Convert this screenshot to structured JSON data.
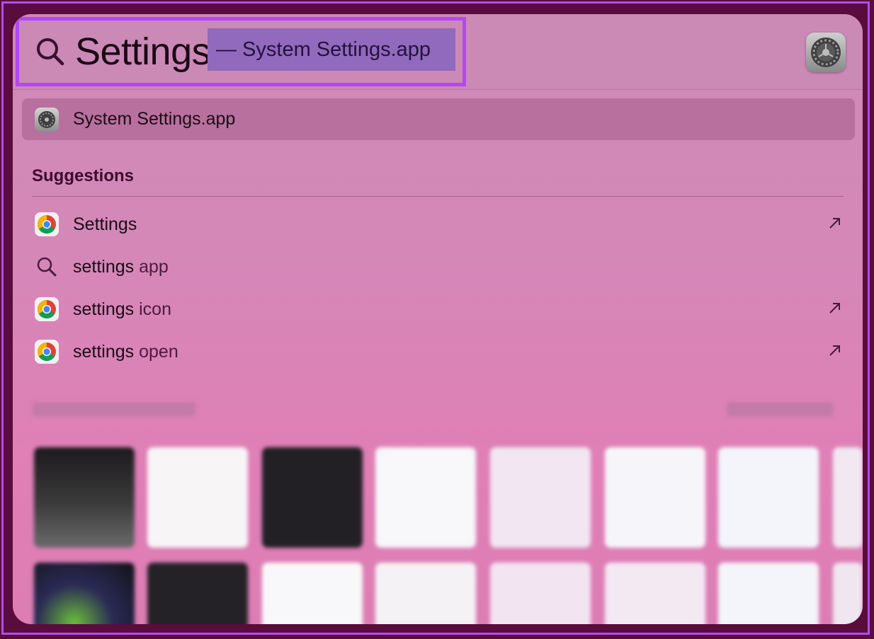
{
  "search": {
    "query": "Settings",
    "completion": "— System Settings.app"
  },
  "top_hit": {
    "label": "System Settings.app",
    "icon": "gear-icon"
  },
  "suggestions": {
    "title": "Suggestions",
    "items": [
      {
        "query_part": "Settings",
        "rest": "",
        "icon": "chrome-icon",
        "has_arrow": true
      },
      {
        "query_part": "settings",
        "rest": " app",
        "icon": "search-icon",
        "has_arrow": false
      },
      {
        "query_part": "settings",
        "rest": " icon",
        "icon": "chrome-icon",
        "has_arrow": true
      },
      {
        "query_part": "settings",
        "rest": " open",
        "icon": "chrome-icon",
        "has_arrow": true
      }
    ]
  },
  "colors": {
    "highlight_border": "#b347f5",
    "completion_bg": "#9169bd",
    "top_hit_bg": "#b8709e"
  }
}
